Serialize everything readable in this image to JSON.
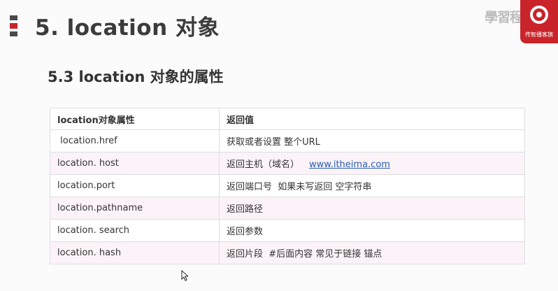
{
  "slide": {
    "title": "5. location 对象",
    "subtitle": "5.3 location 对象的属性",
    "logo_text": "學習程序员",
    "logo_sub": "传智播客旗"
  },
  "table": {
    "headers": [
      "location对象属性",
      "返回值"
    ],
    "rows": [
      {
        "prop": " location.href",
        "value": "获取或者设置 整个URL",
        "link": ""
      },
      {
        "prop": "location. host",
        "value": "返回主机（域名）",
        "link": "www.itheima.com"
      },
      {
        "prop": "location.port",
        "value": "返回端口号  如果未写返回 空字符串",
        "link": ""
      },
      {
        "prop": "location.pathname",
        "value": "返回路径",
        "link": ""
      },
      {
        "prop": "location. search",
        "value": "返回参数",
        "link": ""
      },
      {
        "prop": "location. hash",
        "value": "返回片段  #后面内容 常见于链接 锚点",
        "link": ""
      }
    ]
  },
  "colors": {
    "accent": "#c9242a",
    "link": "#2a5db0",
    "row_alt": "#fbf3f8"
  }
}
